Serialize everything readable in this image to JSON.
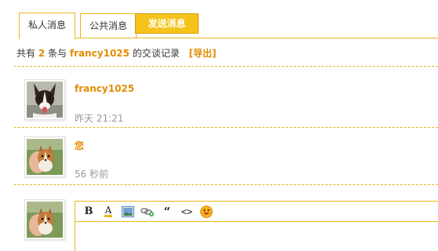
{
  "tabs": {
    "private_label": "私人消息",
    "public_label": "公共消息",
    "send_label": "发送消息"
  },
  "summary": {
    "prefix": "共有",
    "count": "2",
    "middle": "条与",
    "username": "francy1025",
    "suffix": "的交谈记录",
    "export_label": "[导出]"
  },
  "messages": [
    {
      "sender": "francy1025",
      "time": "昨天 21:21"
    },
    {
      "sender": "您",
      "time": "56 秒前"
    }
  ],
  "editor": {
    "tools": [
      "bold-icon",
      "font-color-icon",
      "image-icon",
      "link-icon",
      "quote-icon",
      "code-icon",
      "smiley-icon"
    ],
    "bold_glyph": "B",
    "color_glyph": "A",
    "quote_glyph": "“",
    "code_glyph": "<>"
  },
  "colors": {
    "accent": "#e8b520",
    "accent_text": "#e38c00",
    "send_button": "#f5c31a"
  }
}
